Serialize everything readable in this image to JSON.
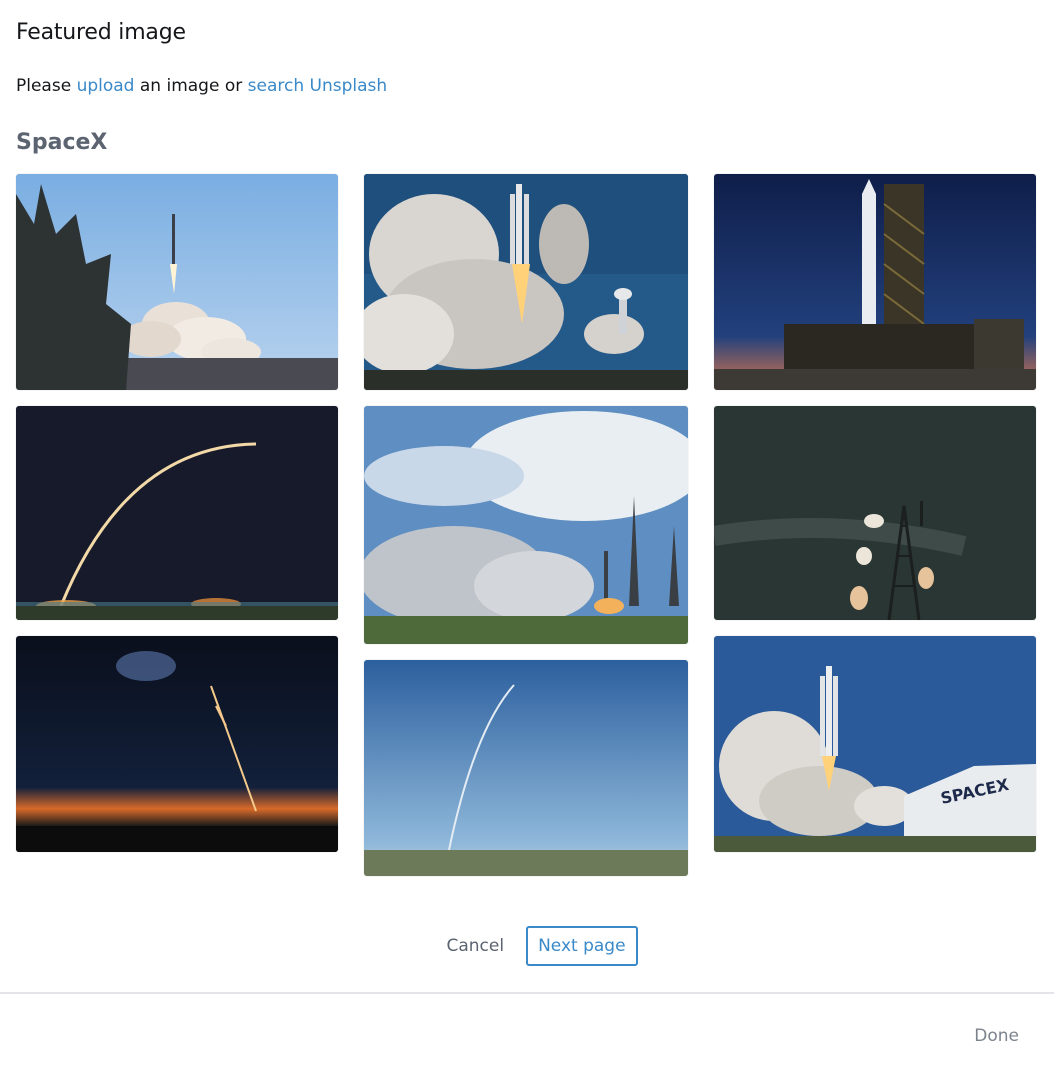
{
  "header": {
    "title": "Featured image",
    "prefix": "Please",
    "upload_link": "upload",
    "middle": "an image or",
    "search_link": "search Unsplash"
  },
  "gallery": {
    "heading": "SpaceX",
    "images": [
      {
        "subject": "Falcon 9 launch behind pine tree, daytime"
      },
      {
        "subject": "Falcon Heavy liftoff with large smoke clouds"
      },
      {
        "subject": "Rocket on launch pad tower at dusk"
      },
      {
        "subject": "Long exposure launch arc at night"
      },
      {
        "subject": "Launch smoke under cloudy sky, spectators on grass"
      },
      {
        "subject": "Antenna tower under starry sky"
      },
      {
        "subject": "Night launch trail over horizon glow"
      },
      {
        "subject": "Rocket trail against blue sky"
      },
      {
        "subject": "Falcon Heavy launch beside SpaceX hangar"
      }
    ],
    "hangar_sign": "SPACEX"
  },
  "pagination": {
    "cancel_label": "Cancel",
    "next_label": "Next page"
  },
  "footer": {
    "done_label": "Done"
  },
  "colors": {
    "link": "#3a89c9",
    "muted": "#5b6470"
  }
}
